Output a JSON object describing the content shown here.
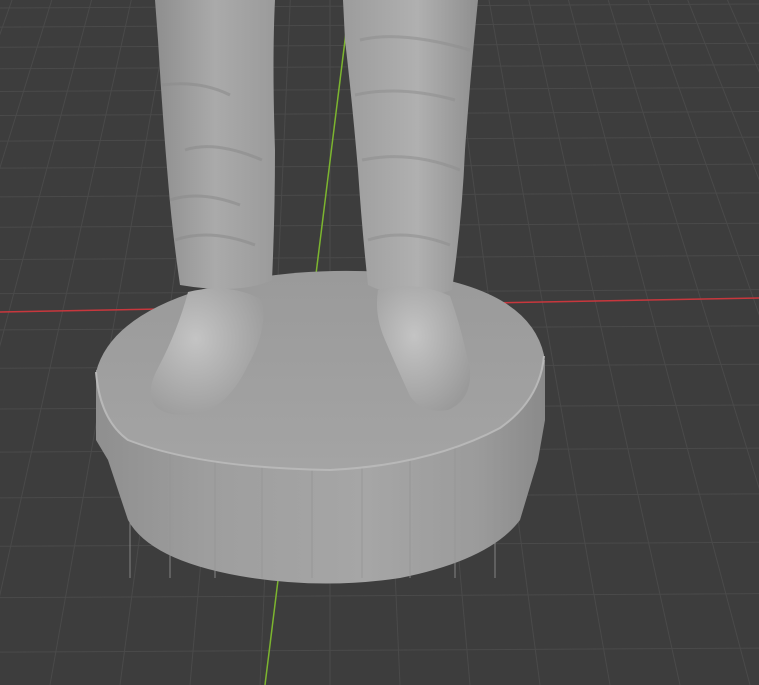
{
  "viewport": {
    "background": "#3d3d3d",
    "grid_color": "#4a4a4a",
    "x_axis_color": "#c8373d",
    "y_axis_color": "#7cb52f",
    "model_color": "#a5a5a5"
  },
  "scene": {
    "objects": [
      "pedestal",
      "left-leg",
      "right-leg",
      "left-shoe",
      "right-shoe"
    ]
  }
}
